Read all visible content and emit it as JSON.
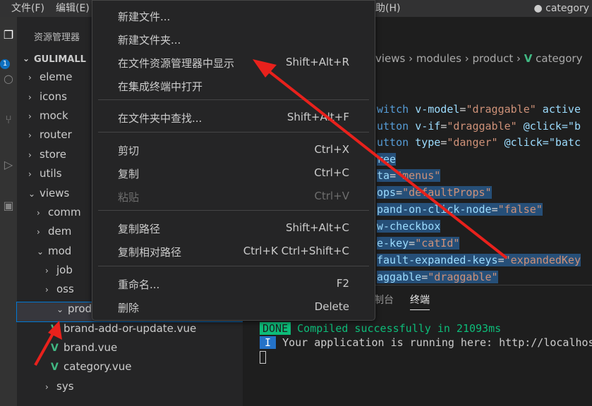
{
  "menubar": {
    "file": "文件(F)",
    "edit": "编辑(E)",
    "help": "助(H)",
    "title": "● category"
  },
  "activity": {
    "badge": "1"
  },
  "sidebar": {
    "title": "资源管理器",
    "section": "GULIMALL",
    "tree": [
      {
        "label": "eleme",
        "chev": "›",
        "icon": ""
      },
      {
        "label": "icons",
        "chev": "›",
        "icon": ""
      },
      {
        "label": "mock",
        "chev": "›",
        "icon": ""
      },
      {
        "label": "router",
        "chev": "›",
        "icon": ""
      },
      {
        "label": "store",
        "chev": "›",
        "icon": ""
      },
      {
        "label": "utils",
        "chev": "›",
        "icon": ""
      },
      {
        "label": "views",
        "chev": "⌄",
        "icon": ""
      },
      {
        "label": "comm",
        "chev": "›",
        "icon": ""
      },
      {
        "label": "dem",
        "chev": "›",
        "icon": ""
      },
      {
        "label": "mod",
        "chev": "⌄",
        "icon": ""
      },
      {
        "label": "job",
        "chev": "›",
        "icon": ""
      },
      {
        "label": "oss",
        "chev": "›",
        "icon": ""
      },
      {
        "label": "product",
        "chev": "⌄",
        "icon": ""
      },
      {
        "label": "brand-add-or-update.vue",
        "chev": "",
        "icon": "V"
      },
      {
        "label": "brand.vue",
        "chev": "",
        "icon": "V"
      },
      {
        "label": "category.vue",
        "chev": "",
        "icon": "V"
      },
      {
        "label": "sys",
        "chev": "›",
        "icon": ""
      }
    ]
  },
  "breadcrumb": {
    "p1": "views",
    "p2": "modules",
    "p3": "product",
    "p4": "category",
    "sep": "›"
  },
  "code": [
    {
      "a": "witch ",
      "b": "v-model",
      "c": "=",
      "d": "\"draggable\"",
      "e": " active"
    },
    {
      "a": "utton ",
      "b": "v-if",
      "c": "=",
      "d": "\"draggable\"",
      "e": " @click=\"b"
    },
    {
      "a": "utton ",
      "b": "type",
      "c": "=",
      "d": "\"danger\"",
      "e": " @click=\"batc"
    },
    {
      "a": "ree",
      "b": "",
      "c": "",
      "d": "",
      "e": ""
    },
    {
      "a": "ta",
      "b": "",
      "c": "=",
      "d": "\"menus\"",
      "e": ""
    },
    {
      "a": "ops",
      "b": "",
      "c": "=",
      "d": "\"defaultProps\"",
      "e": ""
    },
    {
      "a": "pand-on-click-node",
      "b": "",
      "c": "=",
      "d": "\"false\"",
      "e": ""
    },
    {
      "a": "w-checkbox",
      "b": "",
      "c": "",
      "d": "",
      "e": ""
    },
    {
      "a": "e-key",
      "b": "",
      "c": "=",
      "d": "\"catId\"",
      "e": ""
    },
    {
      "a": "fault-expanded-keys",
      "b": "",
      "c": "=",
      "d": "\"expandedKey",
      "e": ""
    },
    {
      "a": "aggable",
      "b": "",
      "c": "=",
      "d": "\"draggable\"",
      "e": ""
    }
  ],
  "panel": {
    "tab_console": "制台",
    "tab_terminal": "终端",
    "done": "DONE",
    "compiled": "Compiled successfully in 21093ms",
    "i": "I",
    "running": "Your application is running here: http://localhos"
  },
  "context_menu": [
    {
      "label": "新建文件...",
      "key": ""
    },
    {
      "label": "新建文件夹...",
      "key": ""
    },
    {
      "label": "在文件资源管理器中显示",
      "key": "Shift+Alt+R"
    },
    {
      "label": "在集成终端中打开",
      "key": ""
    },
    {
      "label": "在文件夹中查找...",
      "key": "Shift+Alt+F"
    },
    {
      "label": "剪切",
      "key": "Ctrl+X"
    },
    {
      "label": "复制",
      "key": "Ctrl+C"
    },
    {
      "label": "粘贴",
      "key": "Ctrl+V"
    },
    {
      "label": "复制路径",
      "key": "Shift+Alt+C"
    },
    {
      "label": "复制相对路径",
      "key": "Ctrl+K Ctrl+Shift+C"
    },
    {
      "label": "重命名...",
      "key": "F2"
    },
    {
      "label": "删除",
      "key": "Delete"
    }
  ],
  "colors": {
    "accent": "#0078d4",
    "vue_green": "#41b883",
    "arrow_red": "#e8211c"
  }
}
